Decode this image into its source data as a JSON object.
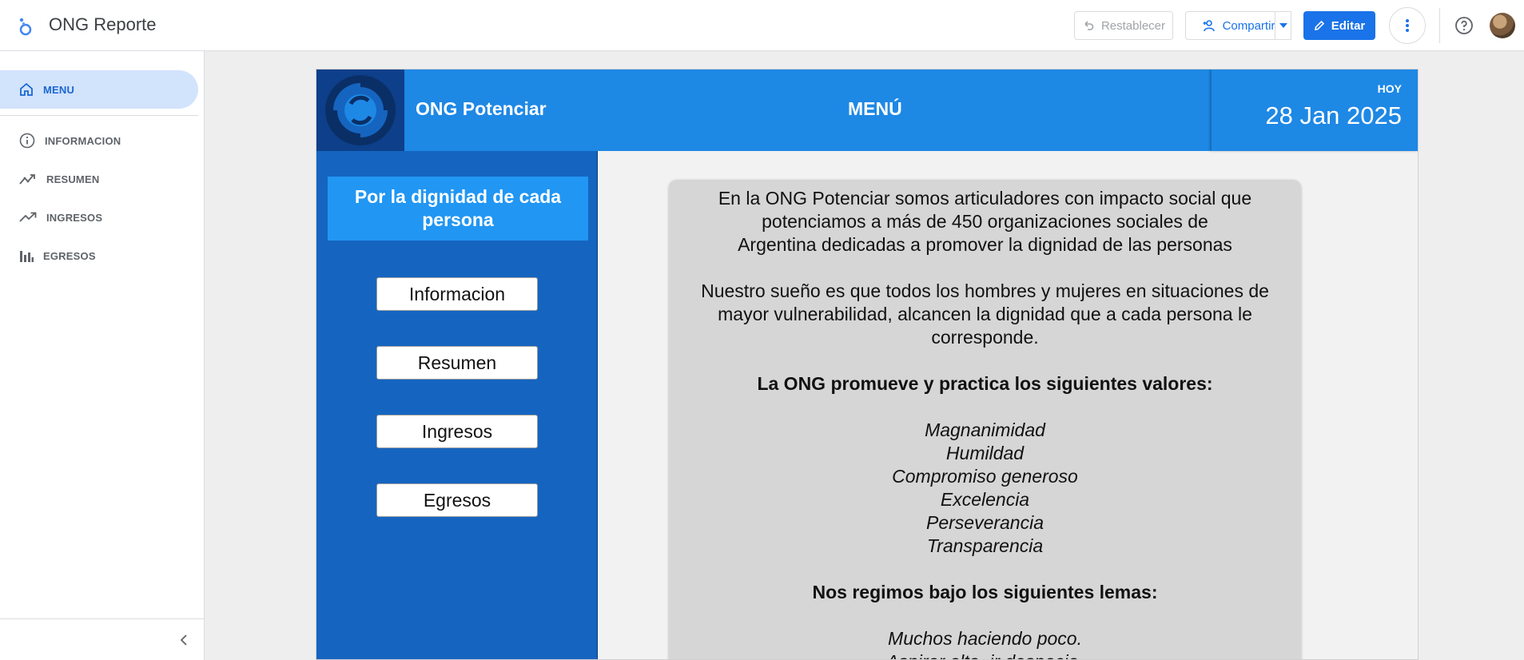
{
  "app": {
    "title": "ONG Reporte"
  },
  "toolbar": {
    "reset_label": "Restablecer",
    "share_label": "Compartir",
    "edit_label": "Editar"
  },
  "sidebar": {
    "items": [
      {
        "label": "MENU",
        "icon": "home-icon",
        "active": true
      },
      {
        "label": "INFORMACION",
        "icon": "info-icon",
        "active": false
      },
      {
        "label": "RESUMEN",
        "icon": "trend-chart-icon",
        "active": false
      },
      {
        "label": "INGRESOS",
        "icon": "trending-up-icon",
        "active": false
      },
      {
        "label": "EGRESOS",
        "icon": "bar-chart-icon",
        "active": false
      }
    ]
  },
  "report": {
    "org_name": "ONG Potenciar",
    "page_heading": "MENÚ",
    "date_label": "HOY",
    "date_value": "28 Jan 2025",
    "motto": "Por la dignidad de cada persona",
    "nav_buttons": [
      "Informacion",
      "Resumen",
      "Ingresos",
      "Egresos"
    ],
    "intro_lines": [
      "En la ONG Potenciar somos articuladores con impacto social que",
      "potenciamos a más de 450 organizaciones sociales de",
      "Argentina dedicadas a promover la dignidad de las personas"
    ],
    "dream_lines": [
      "Nuestro sueño es que todos los hombres y mujeres en situaciones de",
      "mayor vulnerabilidad, alcancen la dignidad que a cada persona le",
      "corresponde."
    ],
    "values_heading": "La ONG promueve y practica los siguientes valores:",
    "values": [
      "Magnanimidad",
      "Humildad",
      "Compromiso generoso",
      "Excelencia",
      "Perseverancia",
      "Transparencia"
    ],
    "mottos_heading": "Nos regimos bajo los siguientes lemas:",
    "mottos": [
      "Muchos haciendo poco.",
      "Aspirar alto, ir despacio."
    ]
  },
  "colors": {
    "accent": "#1a73e8",
    "header_band": "#1e88e5",
    "left_panel": "#1565c0",
    "motto_box": "#2196f3",
    "card": "#d6d6d6"
  }
}
